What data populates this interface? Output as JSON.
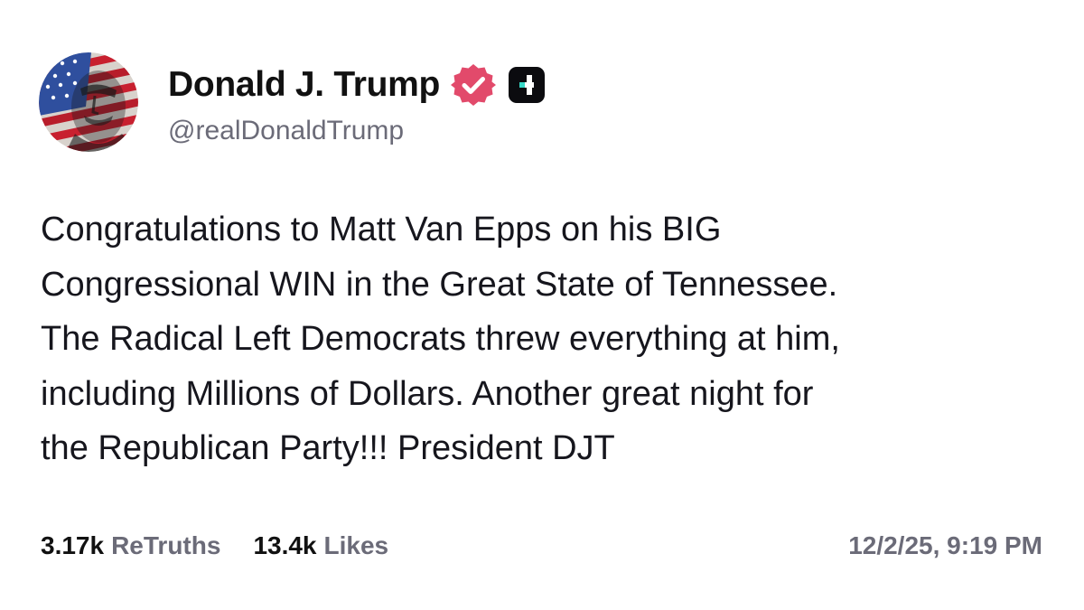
{
  "author": {
    "display_name": "Donald J. Trump",
    "handle": "@realDonaldTrump",
    "verified_badge_icon": "verified-check-icon",
    "subscription_badge_icon": "truth-plus-icon",
    "badge_color": "#e24a6b"
  },
  "post": {
    "lines": [
      "Congratulations to Matt Van Epps on his BIG",
      "Congressional WIN in the Great State of Tennessee.",
      "The Radical Left Democrats threw everything at him,",
      "including Millions of Dollars. Another great night for",
      "the Republican Party!!! President DJT"
    ]
  },
  "stats": {
    "retruths_count": "3.17k",
    "retruths_label": "ReTruths",
    "likes_count": "13.4k",
    "likes_label": "Likes"
  },
  "timestamp": "12/2/25, 9:19 PM"
}
